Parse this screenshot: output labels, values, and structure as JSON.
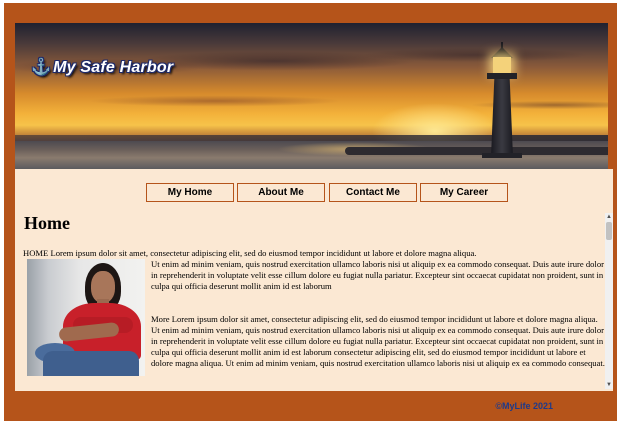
{
  "header": {
    "logo_icon": "anchor-icon",
    "logo_glyph": "⚓",
    "logo_text": "My Safe Harbor"
  },
  "nav": {
    "items": [
      {
        "label": "My Home"
      },
      {
        "label": "About Me"
      },
      {
        "label": "Contact Me"
      },
      {
        "label": "My Career"
      }
    ]
  },
  "main": {
    "title": "Home",
    "intro": "HOME Lorem ipsum dolor sit amet, consectetur adipiscing elit, sed do eiusmod tempor incididunt ut labore et dolore magna aliqua.",
    "paragraph1": "Ut enim ad minim veniam, quis nostrud exercitation ullamco laboris nisi ut aliquip ex ea commodo consequat. Duis aute irure dolor in reprehenderit in voluptate velit esse cillum dolore eu fugiat nulla pariatur. Excepteur sint occaecat cupidatat non proident, sunt in culpa qui officia deserunt mollit anim id est laborum",
    "paragraph2": "More Lorem ipsum dolor sit amet, consectetur adipiscing elit, sed do eiusmod tempor incididunt ut labore et dolore magna aliqua. Ut enim ad minim veniam, quis nostrud exercitation ullamco laboris nisi ut aliquip ex ea commodo consequat. Duis aute irure dolor in reprehenderit in voluptate velit esse cillum dolore eu fugiat nulla pariatur. Excepteur sint occaecat cupidatat non proident, sunt in culpa qui officia deserunt mollit anim id est laborum consectetur adipiscing elit, sed do eiusmod tempor incididunt ut labore et dolore magna aliqua. Ut enim ad minim veniam, quis nostrud exercitation ullamco laboris nisi ut aliquip ex ea commodo consequat."
  },
  "footer": {
    "copyright": "©MyLife 2021"
  },
  "colors": {
    "frame": "#b5541a",
    "content_bg": "#fbe8d3",
    "footer_text": "#1e3a8a"
  }
}
